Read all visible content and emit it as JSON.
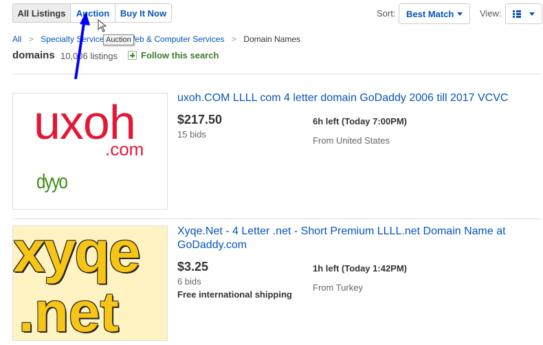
{
  "toolbar": {
    "all_listings": "All Listings",
    "auction": "Auction",
    "buy_it_now": "Buy It Now",
    "sort_label": "Sort:",
    "sort_value": "Best Match",
    "view_label": "View:",
    "view_icon": "list-view-icon"
  },
  "tooltip": "Auction",
  "breadcrumb": {
    "items": [
      "All",
      "Specialty Services",
      "Web & Computer Services",
      "Domain Names"
    ],
    "separator": ">"
  },
  "search": {
    "query": "domains",
    "count": "10,006 listings",
    "follow": "Follow this search"
  },
  "listings": [
    {
      "image": {
        "main": "uxoh",
        "sub": ".com",
        "tag": "dyyo"
      },
      "title": "uxoh.COM LLLL com 4 letter domain GoDaddy 2006 till 2017 VCVC",
      "price": "$217.50",
      "bids": "15 bids",
      "time_left": "6h left (Today 7:00PM)",
      "location": "From United States"
    },
    {
      "image": {
        "line1": "xyqe",
        "line2": ".net"
      },
      "title": "Xyqe.Net - 4 Letter .net - Short Premium LLLL.net Domain Name at GoDaddy.com",
      "price": "$3.25",
      "bids": "6 bids",
      "shipping": "Free international shipping",
      "time_left": "1h left (Today 1:42PM)",
      "location": "From Turkey"
    }
  ],
  "colors": {
    "link": "#0654ba",
    "follow_green": "#3c7b2a",
    "uxoh_red": "#e31837",
    "dyyo_green": "#3a8a14",
    "xyqe_yellow": "#f7c516",
    "annotation_arrow": "#0000ff"
  }
}
